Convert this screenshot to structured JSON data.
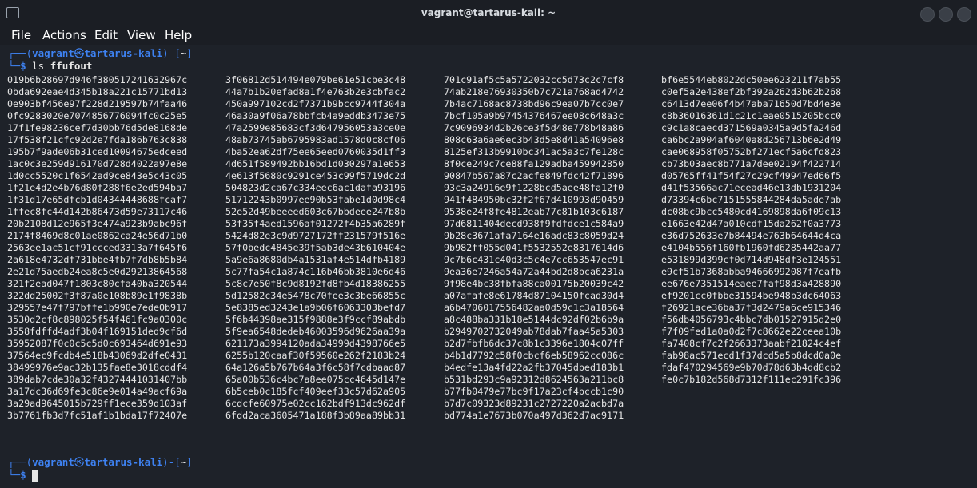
{
  "window": {
    "title": "vagrant@tartarus-kali: ~",
    "app_icon": "terminal-icon"
  },
  "menu": [
    "File",
    "Actions",
    "Edit",
    "View",
    "Help"
  ],
  "prompt": {
    "open": "┌──(",
    "user": "vagrant",
    "at": "㉿",
    "host": "tartarus-kali",
    "close": ")-[",
    "path": "~",
    "end": "]",
    "second": "└─",
    "symbol": "$"
  },
  "command": {
    "cmd": "ls",
    "arg": "ffufout"
  },
  "colors": {
    "prompt_blue": "#3e82f2",
    "background": "#1e2229",
    "text": "#e6e6e6"
  },
  "ls_rows": [
    [
      "019b6b28697d946f380517241632967c",
      "3f06812d514494e079be61e51cbe3c48",
      "701c91af5c5a5722032cc5d73c2c7cf8",
      "bf6e5544eb8022dc50ee623211f7ab55"
    ],
    [
      "0bda692eae4d345b18a221c15771bd13",
      "44a7b1b20efad8a1f4e763b2e3cbfac2",
      "74ab218e76930350b7c721a768ad4742",
      "c0ef5a2e438ef2bf392a262d3b62b268"
    ],
    [
      "0e903bf456e97f228d219597b74faa46",
      "450a997102cd2f7371b9bcc9744f304a",
      "7b4ac7168ac8738bd96c9ea07b7cc0e7",
      "c6413d7ee06f4b47aba71650d7bd4e3e"
    ],
    [
      "0fc9283020e7074856776094fc0c25e5",
      "46a30a9f06a78bbfcb4a9eddb3473e75",
      "7bcf105a9b97454376467ee08c648a3c",
      "c8b36016361d1c21c1eae0515205bcc0"
    ],
    [
      "17f1fe98236cef7d30bb76d5de8168de",
      "47a2599e85683cf3d647956053a3ce0e",
      "7c9096934d2b26ce3f5d48e778b48a86",
      "c9c1a8caecd371569a0345a9d5fa246d"
    ],
    [
      "17f538f21cfc92d2e7fda186b763c838",
      "48ab73745ab6795983ad1578d0c8cf06",
      "808c63a6ae6ec3b43d5e8d41a54096e8",
      "ca6bc2a904af6040a8d256713b6e2d49"
    ],
    [
      "195b7f9ade06b31ced10094675edceed",
      "4ba52ea62df75ee65eed0760035d1ff3",
      "8125ef313b9910bc341ac5a3c7fe128c",
      "cae068958f05752bf271ecf5a6cfd823"
    ],
    [
      "1ac0c3e259d916170d728d4022a97e8e",
      "4d651f589492bb16bd1d030297a1e653",
      "8f0ce249c7ce88fa129adba459942850",
      "cb73b03aec8b771a7dee02194f422714"
    ],
    [
      "1d0cc5520c1f6542ad9ce843e5c43c05",
      "4e613f5680c9291ce453c99f5719dc2d",
      "90847b567a87c2acfe849fdc42f71896",
      "d05765ff41f54f27c29cf49947ed66f5"
    ],
    [
      "1f21e4d2e4b76d80f288f6e2ed594ba7",
      "504823d2ca67c334eec6ac1dafa93196",
      "93c3a24916e9f1228bcd5aee48fa12f0",
      "d41f53566ac71ecead46e13db1931204"
    ],
    [
      "1f31d17e65dfcb1d04344448688fcaf7",
      "51712243b0997ee90b53fabe1d0d98c4",
      "941f484950bc32f2f67d410993d90459",
      "d73394c6bc7151555844284da5ade7ab"
    ],
    [
      "1ffec8fc44d142b86473d59e73117c46",
      "52e52d49beeeed603c67bbdeee247b8b",
      "9538e24f8fe4812eab77c81b103c6187",
      "dc08bc9bcc5480cd4169898da6f09c13"
    ],
    [
      "20b2108d12e965f3e474a923b9abc96f",
      "53f35f4aed1596af01272f4b35a6289f",
      "97d6811404decd938f9fdfdce1c584a9",
      "e1663e42d47a010cdf15da262f0a3773"
    ],
    [
      "2174f8469d8c01ae0862ca24e56d71b0",
      "5424d82e3c9d9727172ff231579f516e",
      "9b28c3671afa7164e16adc83c8059d24",
      "e36d752633e7b84494e763b64644d4ca"
    ],
    [
      "2563ee1ac51cf91ccced3313a7f645f6",
      "57f0bedc4845e39f5ab3de43b610404e",
      "9b982ff055d041f5532552e8317614d6",
      "e4104b556f160fb1960fd6285442aa77"
    ],
    [
      "2a618e4732df731bbe4fb7f7db8b5b84",
      "5a9e6a8680db4a1531af4e514dfb4189",
      "9c7b6c431c40d3c5c4e7cc653547ec91",
      "e531899d399cf0d714d948df3e124551"
    ],
    [
      "2e21d75aedb24ea8c5e0d29213864568",
      "5c77fa54c1a874c116b46bb3810e6d46",
      "9ea36e7246a54a72a44bd2d8bca6231a",
      "e9cf51b7368abba94666992087f7eafb"
    ],
    [
      "321f2ead047f1803c80cfa40ba320544",
      "5c8c7e50f8c9d8192fd8fb4d18386255",
      "9f98e4bc38fbfa88ca00175b20039c42",
      "ee676e7351514eaee7faf98d3a428890"
    ],
    [
      "322dd25002f3f87a0e108b89e1f9838b",
      "5d12582c34e5478c70fee3c3be66855c",
      "a07afafe8e61784d87104150fcad30d4",
      "ef9201cc0fbbe31594be948b3dc64063"
    ],
    [
      "329557e47f797bffe1b990e7ede0b917",
      "5e8385ed3243e1a9b06f6063303befd7",
      "a6b4706017556482aa0d59c1c3a18564",
      "f26921ace36ba37f3d2479a6ce915346"
    ],
    [
      "3530d2cf8c898025f54f461fc9a0300c",
      "5f6b44398ae315f9888e3f9ccf89abdb",
      "a8c488ba331b18e5144dc92df02b6b9a",
      "f56db4056793c4bbc7db01527915d2e0"
    ],
    [
      "3558fdffd4adf3b04f169151ded9cf6d",
      "5f9ea6548dedeb46003596d9626aa39a",
      "b2949702732049ab78dab7faa45a5303",
      "f7f09fed1a0a0d2f7c8662e22ceea10b"
    ],
    [
      "35952087f0c0c5c5d0c693464d691e93",
      "621173a3994120ada34999d4398766e5",
      "b2d7fbfb6dc37c8b1c3396e1804c07ff",
      "fa7408cf7c2f2663373aabf21824c4ef"
    ],
    [
      "37564ec9fcdb4e518b43069d2dfe0431",
      "6255b120caaf30f59560e262f2183b24",
      "b4b1d7792c58f0cbcf6eb58962cc086c",
      "fab98ac571ecd1f37dcd5a5b8dcd0a0e"
    ],
    [
      "38499976e9ac32b135fae8e3018cddf4",
      "64a126a5b767b64a3f6c58f7cdbaad87",
      "b4edfe13a4fd22a2fb37045dbed183b1",
      "fdaf470294569e9b70d78d63b4dd8cb2"
    ],
    [
      "389dab7cde30a32f43274441031407bb",
      "65a00b536c4bc7a8ee075cc4645d147e",
      "b531bd293c9a92312d8624563a211bc8",
      "fe0c7b182d568d7312f111ec291fc396"
    ],
    [
      "3a17dc36d69fe3c86e9e014a49acf69a",
      "6b5ceb0c185fcf409eef33c57d62a905",
      "b77fb0479e77bc9f17a23cf4bccb1c90",
      ""
    ],
    [
      "3a29ad9645015b729ff1ece359d103af",
      "6cdcfe60975e02cc162bdf913dc962df",
      "b7d7c09323d89231c2727220a2acbd7a",
      ""
    ],
    [
      "3b7761fb3d7fc51af1b1bda17f72407e",
      "6fdd2aca3605471a188f3b89aa89bb31",
      "bd774a1e7673b070a497d362d7ac9171",
      ""
    ]
  ]
}
